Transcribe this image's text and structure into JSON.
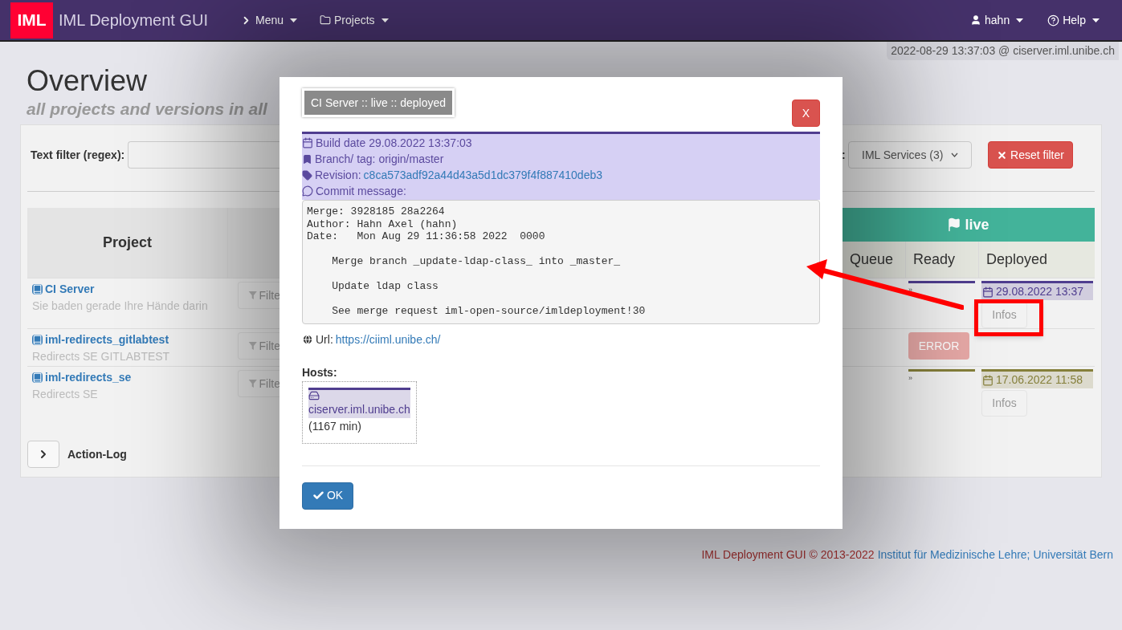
{
  "navbar": {
    "logo": "IML",
    "title": "IML Deployment GUI",
    "menus": [
      {
        "label": "Menu",
        "kind": "chevron"
      },
      {
        "label": "Projects",
        "kind": "folder"
      }
    ],
    "right_menus": [
      {
        "label": "hahn",
        "kind": "user"
      },
      {
        "label": "Help",
        "kind": "help"
      }
    ]
  },
  "server_stamp": "2022-08-29 13:37:03 @ ciserver.iml.unibe.ch",
  "page": {
    "title": "Overview",
    "subtitle": "all projects and versions in all"
  },
  "filters": {
    "text_label": "Text filter (regex):",
    "select_label_tail": ":",
    "select_value": "IML Services (3)",
    "reset_button": "Reset filter"
  },
  "table": {
    "project_header": "Project",
    "phase": "live",
    "phase_columns": [
      "Queue",
      "Ready",
      "Deployed"
    ],
    "rows": [
      {
        "name": "CI Server",
        "description": "Sie baden gerade Ihre Hände darin",
        "filter_button": "Filte",
        "ready": {
          "kind": "marker",
          "label": "»",
          "color": "#4f3d8f"
        },
        "deployed": {
          "date": "29.08.2022 13:37",
          "color": "#4f3d8f",
          "info_button": "Infos"
        }
      },
      {
        "name": "iml-redirects_gitlabtest",
        "description": "Redirects SE GITLABTEST",
        "filter_button": "Filte",
        "ready": {
          "kind": "error",
          "label": "ERROR"
        }
      },
      {
        "name": "iml-redirects_se",
        "description": "Redirects SE",
        "filter_button": "Filte",
        "ready": {
          "kind": "marker",
          "label": "»",
          "color": "#857f3a"
        },
        "deployed": {
          "date": "17.06.2022 11:58",
          "color": "#857f3a",
          "info_button": "Infos"
        }
      }
    ]
  },
  "action_log": "Action-Log",
  "modal": {
    "title": "CI Server :: live :: deployed",
    "close_button": "X",
    "build_date": "Build date 29.08.2022 13:37:03",
    "branch": "Branch/ tag: origin/master",
    "revision_label": "Revision:",
    "revision": "c8ca573adf92a44d43a5d1dc379f4f887410deb3",
    "commit_label": "Commit message:",
    "commit_message": "Merge: 3928185 28a2264\nAuthor: Hahn Axel (hahn)\nDate:   Mon Aug 29 11:36:58 2022  0000\n\n    Merge branch _update-ldap-class_ into _master_\n\n    Update ldap class\n\n    See merge request iml-open-source/imldeployment!30",
    "url_label": "Url:",
    "url": "https://ciiml.unibe.ch/",
    "hosts_label": "Hosts:",
    "hosts": [
      {
        "name": "ciserver.iml.unibe.ch",
        "age": "(1167 min)",
        "color": "#4f3d8f"
      }
    ],
    "ok_button": "OK"
  },
  "footer": {
    "text": "IML Deployment GUI © 2013-2022",
    "link": "Institut für Medizinische Lehre; Universität Bern"
  }
}
